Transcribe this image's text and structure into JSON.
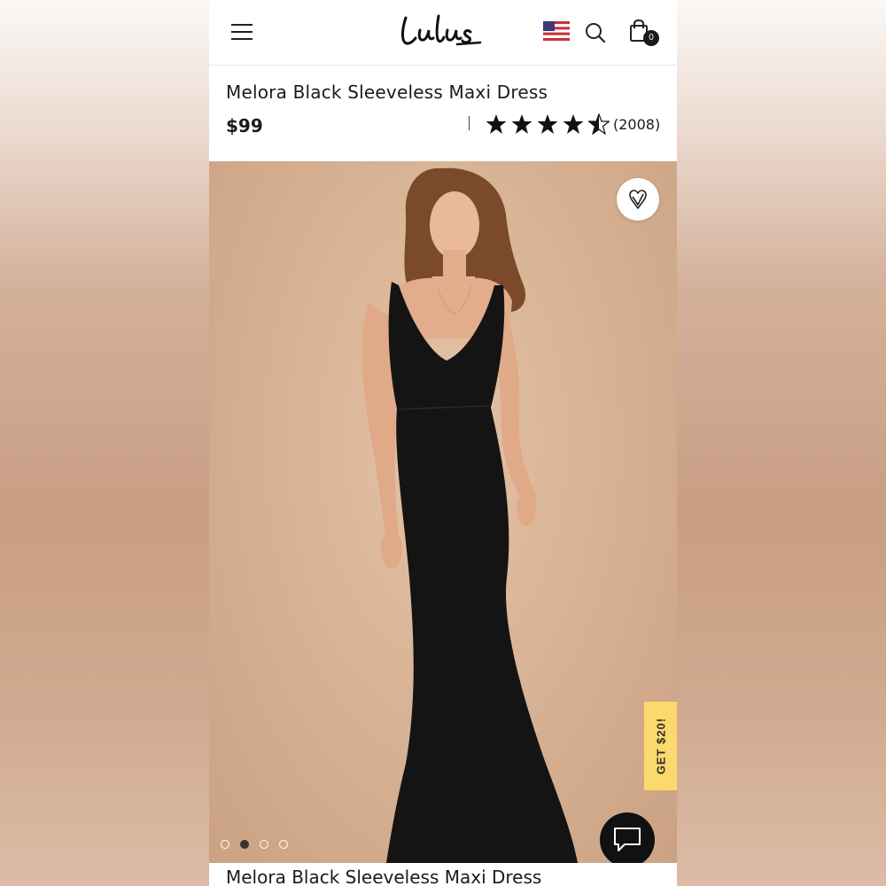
{
  "header": {
    "brand": "Lulus",
    "cart_count": "0",
    "icons": [
      "menu-icon",
      "us-flag-icon",
      "search-icon",
      "shopping-bag-icon"
    ]
  },
  "product": {
    "title": "Melora Black Sleeveless Maxi Dress",
    "price": "$99",
    "rating": 4.5,
    "rating_max": 5,
    "review_count": "(2008)"
  },
  "gallery": {
    "image_count": 4,
    "active_index": 2,
    "promo_label": "GET $20!",
    "icons": [
      "heart-icon",
      "chat-icon"
    ]
  },
  "colors": {
    "background_beige": "#d6b092",
    "promo_yellow": "#fbd96c",
    "text_dark": "#1b1b1b",
    "dress_black": "#141414"
  }
}
